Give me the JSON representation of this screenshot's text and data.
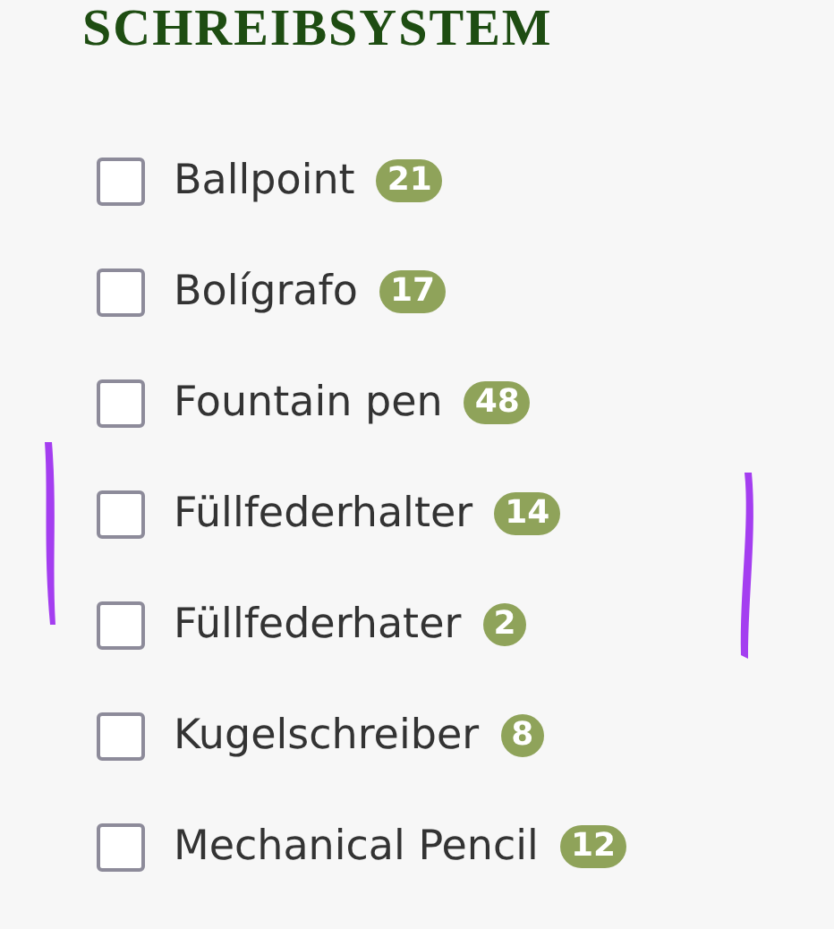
{
  "title": "SCHREIBSYSTEM",
  "options": [
    {
      "label": "Ballpoint",
      "count": "21",
      "checked": false
    },
    {
      "label": "Bolígrafo",
      "count": "17",
      "checked": false
    },
    {
      "label": "Fountain pen",
      "count": "48",
      "checked": false
    },
    {
      "label": "Füllfederhalter",
      "count": "14",
      "checked": false
    },
    {
      "label": "Füllfederhater",
      "count": "2",
      "checked": false
    },
    {
      "label": "Kugelschreiber",
      "count": "8",
      "checked": false
    },
    {
      "label": "Mechanical Pencil",
      "count": "12",
      "checked": false
    }
  ]
}
